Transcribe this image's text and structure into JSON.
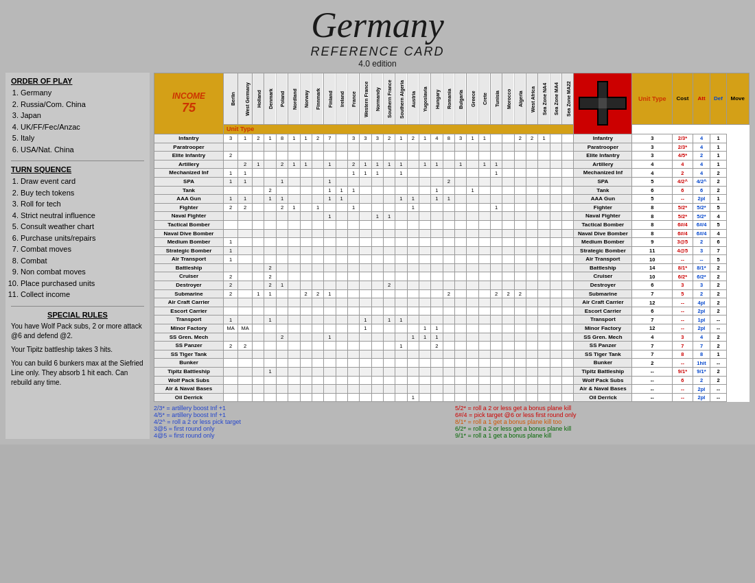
{
  "title": "Germany",
  "subtitle": "REFERENCE CARD",
  "edition": "4.0 edition",
  "left": {
    "order_header": "ORDER OF PLAY",
    "order_items": [
      "Germany",
      "Russia/Com. China",
      "Japan",
      "UK/FF/Fec/Anzac",
      "Italy",
      "USA/Nat. China"
    ],
    "turn_header": "TURN SQUENCE",
    "turn_items": [
      "Draw event card",
      "Buy tech tokens",
      "Roll for tech",
      "Strict neutral influence",
      "Consult weather chart",
      "Purchase units/repairs",
      "Combat moves",
      "Combat",
      "Non combat moves",
      "Place purchased units",
      "Collect income"
    ],
    "special_header": "SPECIAL RULES",
    "special_text_1": "You have Wolf Pack subs, 2 or more attack @6 and defend @2.",
    "special_text_2": "Your Tipitz battleship takes 3 hits.",
    "special_text_3": "You can build 6 bunkers max at the Siefried Line only. They absorb 1 hit each. Can rebuild any time."
  },
  "income": "INCOME",
  "income_num": "75",
  "columns": [
    "Berlin",
    "West Germany",
    "Holland",
    "Denmark",
    "Poland",
    "Nordland",
    "Norway",
    "Finnmark",
    "Finland",
    "Ireland",
    "France",
    "Western France",
    "Normandy",
    "Southern France",
    "Southern Algeria",
    "Austria",
    "Yugoslavia",
    "Hungary",
    "Romania",
    "Bulgaria",
    "Greece",
    "Crete",
    "Tunisia",
    "Morocco",
    "Algeria",
    "West Africa",
    "Sea Zone NA4",
    "Sea Zone MA4",
    "Sea Zone MA22"
  ],
  "units": [
    {
      "name": "Infantry",
      "cols": "3 1 2 1 8 1 1 2 7 . 3 3 3 2 1 2 1 4 8 3 1 1 . . 2 2 1",
      "cost": 3,
      "att": "2/3*",
      "def": 4,
      "move": 1
    },
    {
      "name": "Paratrooper",
      "cols": ". . . . . . . . . . . . . . . . . . . . . . . . . . .",
      "cost": 3,
      "att": "2/3*",
      "def": 4,
      "move": 1
    },
    {
      "name": "Elite Infantry",
      "cols": "2 . . . . . . . . . . . . . . . . . . . . . . . . . .",
      "cost": 3,
      "att": "4/5*",
      "def": 2,
      "move": 1
    },
    {
      "name": "Artillery",
      "cols": ". 2 1 . 2 1 1 . 1 . 2 1 1 1 1 . 1 1 . 1 . 1 1 . . . .",
      "cost": 4,
      "att": 4,
      "def": 4,
      "move": 1
    },
    {
      "name": "Mechanized Inf",
      "cols": "1 1 . . . . . . . . 1 1 1 . 1 . . . . . . . 1 . . . .",
      "cost": 4,
      "att": 2,
      "def": 4,
      "move": 2
    },
    {
      "name": "SPA",
      "cols": "1 1 . . 1 . . . 1 . . . . . . . . . 2 . . . . . . . .",
      "cost": 5,
      "att": "4/2^",
      "def": "4/2^",
      "move": 2
    },
    {
      "name": "Tank",
      "cols": ". . . 2 . . . . 1 1 1 . . . . . . 1 . . 1 . . . . . .",
      "cost": 6,
      "att": 6,
      "def": 6,
      "move": 2
    },
    {
      "name": "AAA Gun",
      "cols": "1 1 . 1 1 . . . 1 1 . . . . 1 1 . 1 1 . . . . . . . .",
      "cost": 5,
      "att": "--",
      "def": "2pl",
      "move": 1
    },
    {
      "name": "Fighter",
      "cols": "2 2 . . 2 1 . 1 . . 1 . . . . 1 . . . . . . 1 . . . .",
      "cost": 8,
      "att": "5/2*",
      "def": "5/2*",
      "move": 5
    },
    {
      "name": "Naval Fighter",
      "cols": ". . . . . . . . 1 . . . 1 1 . . . . . . . . . . . . .",
      "cost": 8,
      "att": "5/2*",
      "def": "5/2*",
      "move": 4
    },
    {
      "name": "Tactical Bomber",
      "cols": ". . . . . . . . . . . . . . . . . . . . . . . . . . .",
      "cost": 8,
      "att": "6#/4",
      "def": "6#/4",
      "move": 5
    },
    {
      "name": "Naval Dive Bomber",
      "cols": ". . . . . . . . . . . . . . . . . . . . . . . . . . .",
      "cost": 8,
      "att": "6#/4",
      "def": "6#/4",
      "move": 4
    },
    {
      "name": "Medium Bomber",
      "cols": "1 . . . . . . . . . . . . . . . . . . . . . . . . . .",
      "cost": 9,
      "att": "3@5",
      "def": 2,
      "move": 6
    },
    {
      "name": "Strategic Bomber",
      "cols": "1 . . . . . . . . . . . . . . . . . . . . . . . . . .",
      "cost": 11,
      "att": "4@5",
      "def": 3,
      "move": 7
    },
    {
      "name": "Air Transport",
      "cols": "1 . . . . . . . . . . . . . . . . . . . . . . . . . .",
      "cost": 10,
      "att": "--",
      "def": "--",
      "move": 5
    },
    {
      "name": "Battleship",
      "cols": ". . . 2 . . . . . . . . . . . . . . . . . . . . . . .",
      "cost": 14,
      "att": "8/1*",
      "def": "8/1*",
      "move": 2
    },
    {
      "name": "Cruiser",
      "cols": "2 . . 2 . . . . . . . . . . . . . . . . . . . . . . .",
      "cost": 10,
      "att": "6/2*",
      "def": "6/2*",
      "move": 2
    },
    {
      "name": "Destroyer",
      "cols": "2 . . 2 1 . . . . . . . . 2 . . . . . . . . . . . . .",
      "cost": 6,
      "att": 3,
      "def": 3,
      "move": 2
    },
    {
      "name": "Submarine",
      "cols": "2 . 1 1 . . 2 2 1 . . . . . . . . . 2 . . . 2 2 2 . .",
      "cost": 7,
      "att": 5,
      "def": 2,
      "move": 2
    },
    {
      "name": "Air Craft Carrier",
      "cols": ". . . . . . . . . . . . . . . . . . . . . . . . . . .",
      "cost": 12,
      "att": "--",
      "def": "4pl",
      "move": 2
    },
    {
      "name": "Escort Carrier",
      "cols": ". . . . . . . . . . . . . . . . . . . . . . . . . . .",
      "cost": 6,
      "att": "--",
      "def": "2pl",
      "move": 2
    },
    {
      "name": "Transport",
      "cols": "1 . . 1 . . . . . . . 1 . 1 1 . . . . . . . . . . . .",
      "cost": 7,
      "att": "--",
      "def": "1pl",
      "move": "--"
    },
    {
      "name": "Minor Factory",
      "cols": "MA MA . . . . . . . . . 1 . . . . 1 1 . . . . . . . . .",
      "cost": 12,
      "att": "--",
      "def": "2pl",
      "move": "--"
    },
    {
      "name": "SS Gren. Mech",
      "cols": ". . . . 2 . . . 1 . . . . . . 1 1 1 . . . . . . . . .",
      "cost": 4,
      "att": 3,
      "def": 4,
      "move": 2
    },
    {
      "name": "SS Panzer",
      "cols": "2 2 . . . . . . . . . . . . 1 . . 2 . . . . . . . . .",
      "cost": 7,
      "att": 7,
      "def": 7,
      "move": 2
    },
    {
      "name": "SS Tiger Tank",
      "cols": ". . . . . . . . . . . . . . . . . . . . . . . . . . .",
      "cost": 7,
      "att": 8,
      "def": 8,
      "move": 1
    },
    {
      "name": "Bunker",
      "cols": ". . . . . . . . . . . . . . . . . . . . . . . . . . .",
      "cost": 2,
      "att": "--",
      "def": "1hit",
      "move": "--"
    },
    {
      "name": "Tipitz Battleship",
      "cols": ". . . 1 . . . . . . . . . . . . . . . . . . . . . . .",
      "cost": "--",
      "att": "9/1*",
      "def": "9/1*",
      "move": 2
    },
    {
      "name": "Wolf Pack Subs",
      "cols": ". . . . . . . . . . . . . . . . . . . . . . . . . . .",
      "cost": "--",
      "att": 6,
      "def": 2,
      "move": 2
    },
    {
      "name": "Air & Naval Bases",
      "cols": ". . . . . . . . . . . . . . . . . . . . . . . . . . .",
      "cost": "--",
      "att": "--",
      "def": "2pl",
      "move": "--"
    },
    {
      "name": "Oil Derrick",
      "cols": ". . . . . . . . . . . . . . . 1 . . . . . . . . . . .",
      "cost": "--",
      "att": "--",
      "def": "2pl",
      "move": "--"
    }
  ],
  "notes": {
    "left": [
      "2/3* = artillery boost Inf +1",
      "4/5* = artillery boost Inf +1",
      "4/2^ = roll a 2 or less pick target",
      "3@5 = first round only",
      "4@5 = first round only"
    ],
    "right": [
      "5/2* = roll a 2 or less get a bonus plane kill",
      "6#/4 = pick target @6 or less first round only",
      "8/1* = roll a 1 get a bonus plane kill too",
      "6/2* = roll a 2 or less get a bonus plane kill",
      "9/1* = roll a 1 get a bonus plane kill"
    ]
  }
}
